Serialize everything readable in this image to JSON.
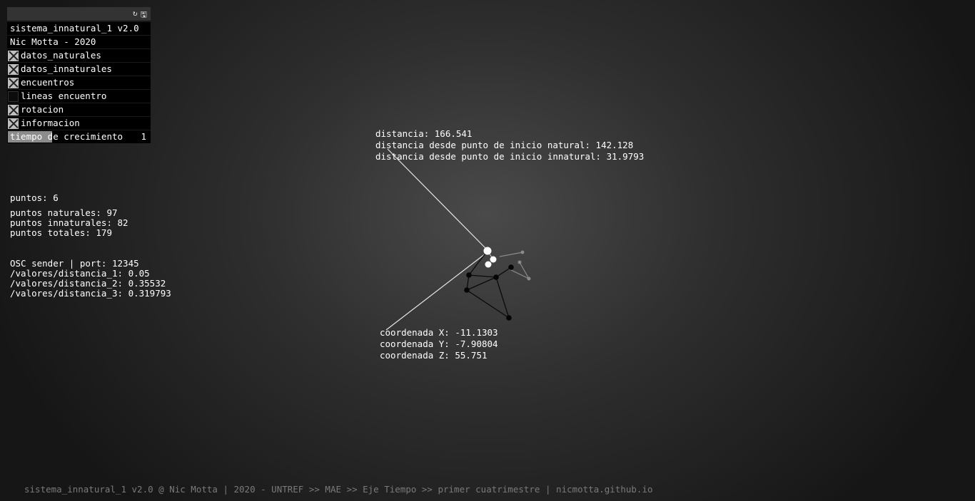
{
  "gui": {
    "header_icons": [
      "refresh-icon",
      "save-icon"
    ],
    "title": "sistema_innatural_1 v2.0",
    "author": "Nic Motta - 2020",
    "toggles": [
      {
        "label": "datos_naturales",
        "checked": true
      },
      {
        "label": "datos_innaturales",
        "checked": true
      },
      {
        "label": "encuentros",
        "checked": true
      },
      {
        "label": "lineas encuentro",
        "checked": false
      },
      {
        "label": "rotacion",
        "checked": true
      },
      {
        "label": "informacion",
        "checked": true
      }
    ],
    "slider": {
      "label": "tiempo de crecimiento",
      "value": "1"
    }
  },
  "stats": {
    "puntos": "puntos: 6",
    "naturales": "puntos naturales: 97",
    "innaturales": "puntos innaturales: 82",
    "totales": "puntos totales: 179"
  },
  "osc": {
    "sender": "OSC sender | port: 12345",
    "d1": "/valores/distancia_1: 0.05",
    "d2": "/valores/distancia_2: 0.35532",
    "d3": "/valores/distancia_3: 0.319793"
  },
  "distance_info": {
    "distancia": "distancia: 166.541",
    "natural": "distancia desde punto de inicio natural: 142.128",
    "innatural": "distancia desde punto de inicio innatural: 31.9793"
  },
  "coords": {
    "x": "coordenada X: -11.1303",
    "y": "coordenada Y: -7.90804",
    "z": "coordenada Z: 55.751"
  },
  "footer": "sistema_innatural_1 v2.0 @ Nic Motta | 2020 - UNTREF >> MAE >> Eje Tiempo >> primer cuatrimestre | nicmotta.github.io",
  "colors": {
    "natural_points": "#ffffff",
    "innatural_points": "#000000",
    "ghost_points": "#888888"
  }
}
